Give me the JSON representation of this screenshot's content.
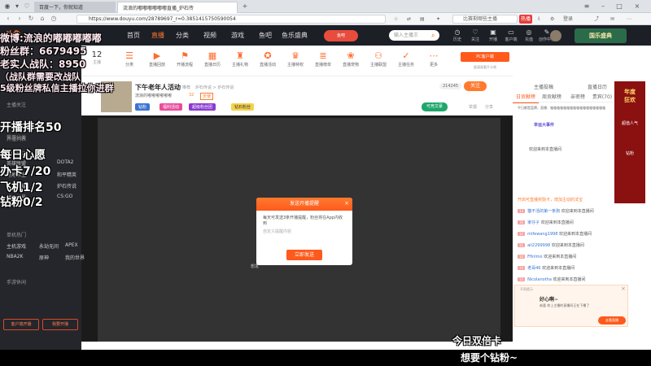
{
  "browser": {
    "tabs": [
      "百度一下，你就知道",
      "流浪的嘟嘟嘟嘟嘟嘟直播_炉石传"
    ],
    "url": "https://www.douyu.com/28789697_r=0.3851415750590054",
    "search_placeholder": "比赛剩哪些主播",
    "hot_badge": "热播",
    "login": "登录"
  },
  "site": {
    "logo": "斗鱼",
    "nav": [
      "首页",
      "直播",
      "分类",
      "视频",
      "游戏",
      "鱼吧",
      "鱼乐盛典"
    ],
    "search_placeholder": "输入主播王 ",
    "badge": "鱼吧",
    "icons": [
      "历史",
      "关注",
      "开播",
      "客户端",
      "充值",
      "创作中心"
    ],
    "promo": "国乐盛典"
  },
  "categories": {
    "count": "12",
    "count_label": "主播",
    "items": [
      "分类",
      "直播回放",
      "开播流程",
      "直播日历",
      "主播礼物",
      "直播活动",
      "主播特权",
      "直播榜单",
      "直播宠物",
      "主播联盟",
      "主播任务",
      "更多"
    ],
    "pc_client": "PC客户端",
    "client_sub": "超清观看不卡顿"
  },
  "sidebar": {
    "follow": "主播关注",
    "sections": [
      "开播列表",
      "我的关注",
      "常用分类",
      "单机热门",
      "手游休闲"
    ],
    "games": [
      "英雄联盟",
      "DOTA2",
      "绝地求生",
      "和平精英",
      "王者荣耀",
      "炉石传说",
      "魔兽世界",
      "CS:GO",
      "主机游戏",
      "永劫无间",
      "APEX",
      "NBA2K",
      "原神",
      "我的世界"
    ],
    "btn_download": "客户端开播",
    "btn_apply": "我要开播"
  },
  "room": {
    "title": "下午老年人活动",
    "tag": "推荐",
    "category_path": "炉石传说 > 炉石传说",
    "anchor": "流浪的嘟嘟嘟嘟嘟嘟",
    "level": "32",
    "fans": "天使",
    "heat": "热",
    "viewers": "214245",
    "follow_btn": "关注",
    "badges": [
      "钻粉",
      "福利活动",
      "超级粉丝团",
      "钻石粉丝"
    ],
    "bet_btn": "可竞文豪",
    "report": "举报",
    "share": "分享"
  },
  "overlay": {
    "weibo": "微博:流浪的嘟嘟嘟嘟嘟",
    "fanclub": "粉丝群：6679495",
    "oldfans": "老实人战队：8950",
    "note": "（战队群需要改战队",
    "vip": "5级粉丝牌私信主播拉你进群",
    "rank": "开播排名50",
    "wish": "每日心愿",
    "card": "办卡7/20",
    "plane": "飞机1/2",
    "diamond": "钻粉0/2",
    "subtitle1": "今日双倍卡",
    "subtitle2": "想要个钻粉~"
  },
  "modal": {
    "title": "发送开播提醒",
    "body": "每天可发送3条开播提醒，粉丝将在App内收到",
    "input_placeholder": "自定义提醒内容",
    "button": "立即发送",
    "hint": "想发"
  },
  "right": {
    "tabs": [
      "主播投稿",
      "直播日历"
    ],
    "subtabs": [
      "日贡献榜",
      "周贡献榜",
      "亲密榜",
      "贵宾(70)",
      "粉丝团"
    ],
    "notice": "平日都是蓝牌，直播：嗑嗑嗑嗑嗑嗑嗑嗑嗑嗑嗑嗑嗑嗑嗑嗑嗑",
    "event": "幸运大事件",
    "welcome_prefix": "欢迎来到本直播间",
    "announce": "开启可直播奖励卡，增加主动的法宝",
    "chat": [
      {
        "lv": "13",
        "user": "猫不活的第一条狗",
        "text": "欢迎来到本直播间"
      },
      {
        "lv": "16",
        "user": "家仔子",
        "text": "欢迎来到本直播间"
      },
      {
        "lv": "12",
        "user": "mifewang1998",
        "text": "欢迎来到本直播间"
      },
      {
        "lv": "11",
        "user": "ali2299998",
        "text": "欢迎来到本直播间"
      },
      {
        "lv": "10",
        "user": "Ffinlmo",
        "text": "欢迎来到本直播间"
      },
      {
        "lv": "14",
        "user": "老哥46",
        "text": "欢迎来到本直播间"
      },
      {
        "lv": "15",
        "user": "Nicolanotha",
        "text": "欢迎来到本直播间"
      }
    ],
    "popup_title": "不再提示",
    "popup_msg": "好心啊~",
    "popup_sub": "恭喜 你上主播的直播间正在下播了",
    "popup_btn": "去看直播",
    "ad_texts": [
      "年度",
      "狂欢",
      "超值人气",
      "钻粉"
    ]
  }
}
